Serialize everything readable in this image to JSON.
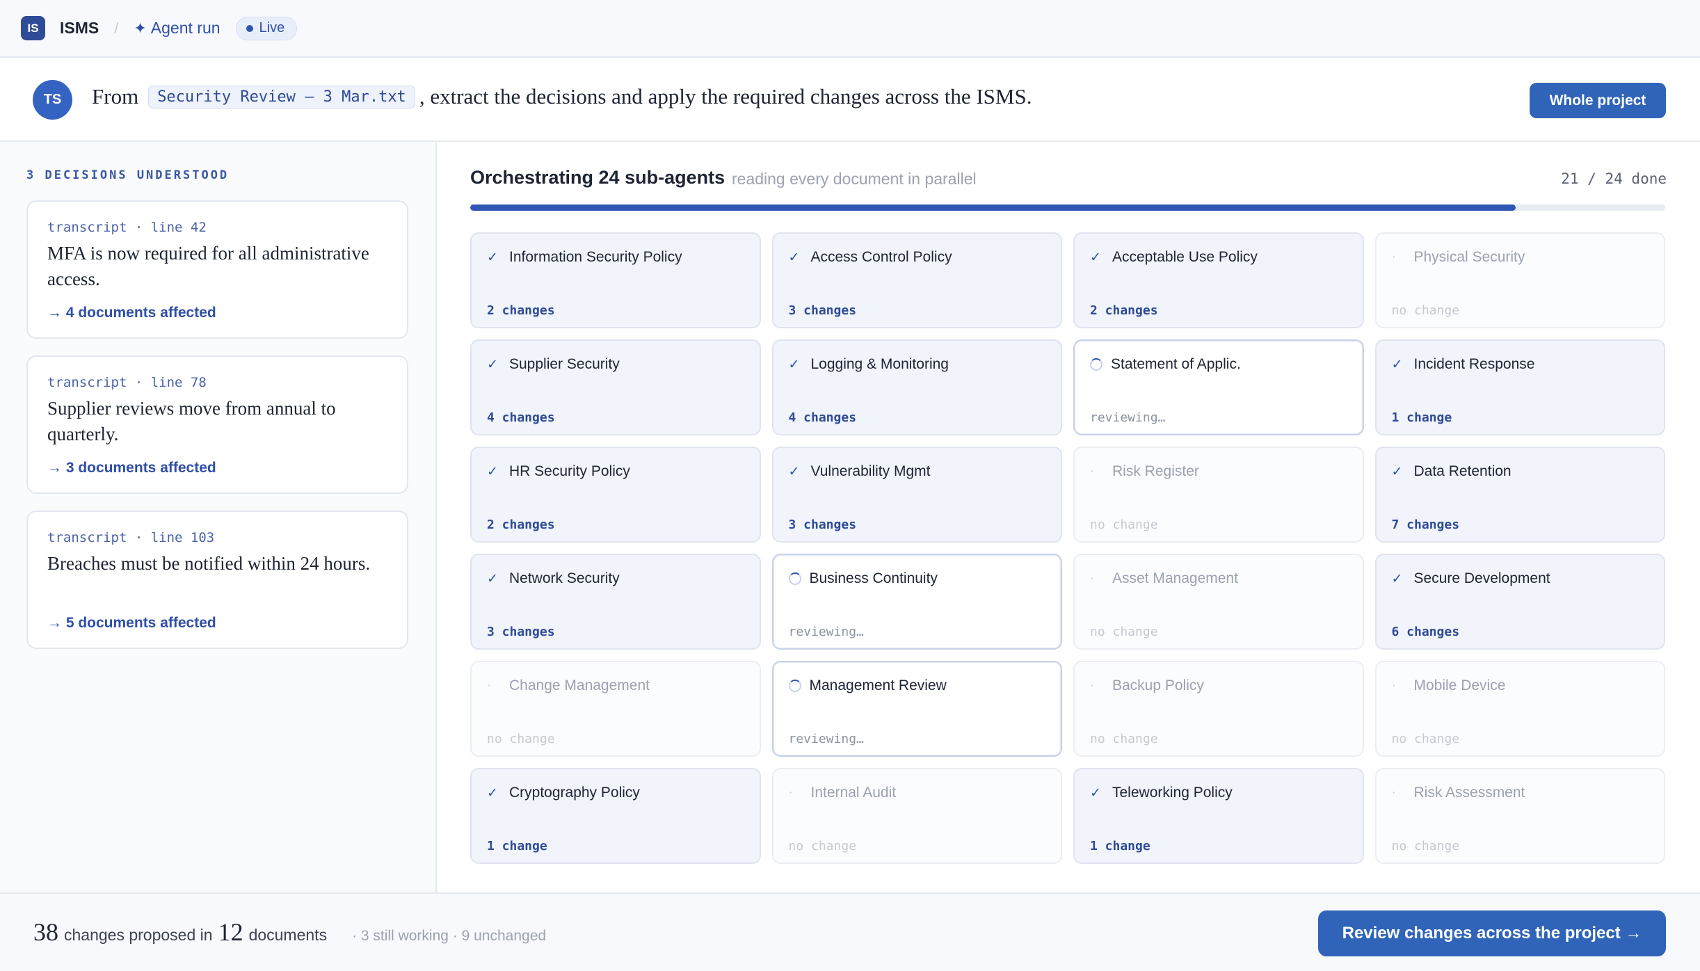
{
  "header": {
    "app_badge": "IS",
    "app_name": "ISMS",
    "separator": "/",
    "agent_run_icon": "sparkle-icon",
    "agent_run_glyph": "✦",
    "agent_run_label": "Agent run",
    "live_label": "Live"
  },
  "instruction": {
    "avatar": "TS",
    "prefix": "From",
    "file": "Security Review — 3 Mar.txt",
    "suffix": ", extract the decisions and apply the required changes across the ISMS.",
    "scope_button": "Whole project"
  },
  "decisions": {
    "title": "3 DECISIONS UNDERSTOOD",
    "items": [
      {
        "ref": "transcript · line 42",
        "text": "MFA is now required for all administrative access.",
        "affected": "→ 4 documents affected"
      },
      {
        "ref": "transcript · line 78",
        "text": "Supplier reviews move from annual to quarterly.",
        "affected": "→ 3 documents affected"
      },
      {
        "ref": "transcript · line 103",
        "text": "Breaches must be notified within 24 hours.",
        "affected": "→ 5 documents affected"
      }
    ]
  },
  "orchestration": {
    "title": "Orchestrating 24 sub-agents",
    "subtitle": "reading every document in parallel",
    "count": "21 / 24 done",
    "progress": 0.875,
    "cards": [
      {
        "name": "Information Security Policy",
        "state": "done",
        "status": "2 changes"
      },
      {
        "name": "Access Control Policy",
        "state": "done",
        "status": "3 changes"
      },
      {
        "name": "Acceptable Use Policy",
        "state": "done",
        "status": "2 changes"
      },
      {
        "name": "Physical Security",
        "state": "unchanged",
        "status": "no change"
      },
      {
        "name": "Supplier Security",
        "state": "done",
        "status": "4 changes"
      },
      {
        "name": "Logging & Monitoring",
        "state": "done",
        "status": "4 changes"
      },
      {
        "name": "Statement of Applic.",
        "state": "working",
        "status": "reviewing…"
      },
      {
        "name": "Incident Response",
        "state": "done",
        "status": "1 change"
      },
      {
        "name": "HR Security Policy",
        "state": "done",
        "status": "2 changes"
      },
      {
        "name": "Vulnerability Mgmt",
        "state": "done",
        "status": "3 changes"
      },
      {
        "name": "Risk Register",
        "state": "unchanged",
        "status": "no change"
      },
      {
        "name": "Data Retention",
        "state": "done",
        "status": "7 changes"
      },
      {
        "name": "Network Security",
        "state": "done",
        "status": "3 changes"
      },
      {
        "name": "Business Continuity",
        "state": "working",
        "status": "reviewing…"
      },
      {
        "name": "Asset Management",
        "state": "unchanged",
        "status": "no change"
      },
      {
        "name": "Secure Development",
        "state": "done",
        "status": "6 changes"
      },
      {
        "name": "Change Management",
        "state": "unchanged",
        "status": "no change"
      },
      {
        "name": "Management Review",
        "state": "working",
        "status": "reviewing…"
      },
      {
        "name": "Backup Policy",
        "state": "unchanged",
        "status": "no change"
      },
      {
        "name": "Mobile Device",
        "state": "unchanged",
        "status": "no change"
      },
      {
        "name": "Cryptography Policy",
        "state": "done",
        "status": "1 change"
      },
      {
        "name": "Internal Audit",
        "state": "unchanged",
        "status": "no change"
      },
      {
        "name": "Teleworking Policy",
        "state": "done",
        "status": "1 change"
      },
      {
        "name": "Risk Assessment",
        "state": "unchanged",
        "status": "no change"
      }
    ]
  },
  "footer": {
    "changes_count": "38",
    "changes_label": "changes proposed in",
    "docs_count": "12",
    "docs_label": "documents",
    "extra": "· 3 still working · 9 unchanged",
    "review_button": "Review changes across the project →"
  }
}
